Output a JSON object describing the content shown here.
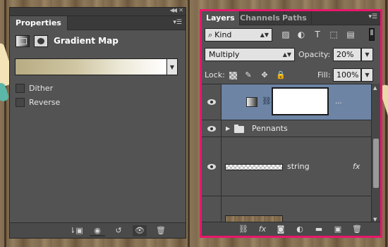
{
  "properties": {
    "tab": "Properties",
    "title": "Gradient Map",
    "gradient": {
      "from": "#b7ab82",
      "to": "#ffffff"
    },
    "options": [
      {
        "label": "Dither",
        "checked": false
      },
      {
        "label": "Reverse",
        "checked": false
      }
    ],
    "footer_icons": [
      "clip-to-layer-icon",
      "view-previous-state-icon",
      "reset-icon",
      "visibility-icon",
      "delete-icon"
    ]
  },
  "layers": {
    "tabs": [
      "Layers",
      "Channels",
      "Paths"
    ],
    "active_tab": "Layers",
    "filter": {
      "kind": "Kind"
    },
    "blend_mode": "Multiply",
    "opacity_label": "Opacity:",
    "opacity": "20%",
    "lock_label": "Lock:",
    "fill_label": "Fill:",
    "fill": "100%",
    "items": [
      {
        "type": "adjustment",
        "name": "",
        "selected": true,
        "more": "..."
      },
      {
        "type": "group",
        "name": "Pennants"
      },
      {
        "type": "layer",
        "name": "string",
        "fx": "fx"
      },
      {
        "type": "layer",
        "name": ""
      }
    ],
    "footer_icons": [
      "link-layers-icon",
      "fx-icon",
      "add-mask-icon",
      "adjustment-layer-icon",
      "new-group-icon",
      "new-layer-icon",
      "delete-layer-icon"
    ],
    "fx_label": "fx",
    "accent_color": "#e8176b",
    "selected_color": "#6d84a5"
  }
}
